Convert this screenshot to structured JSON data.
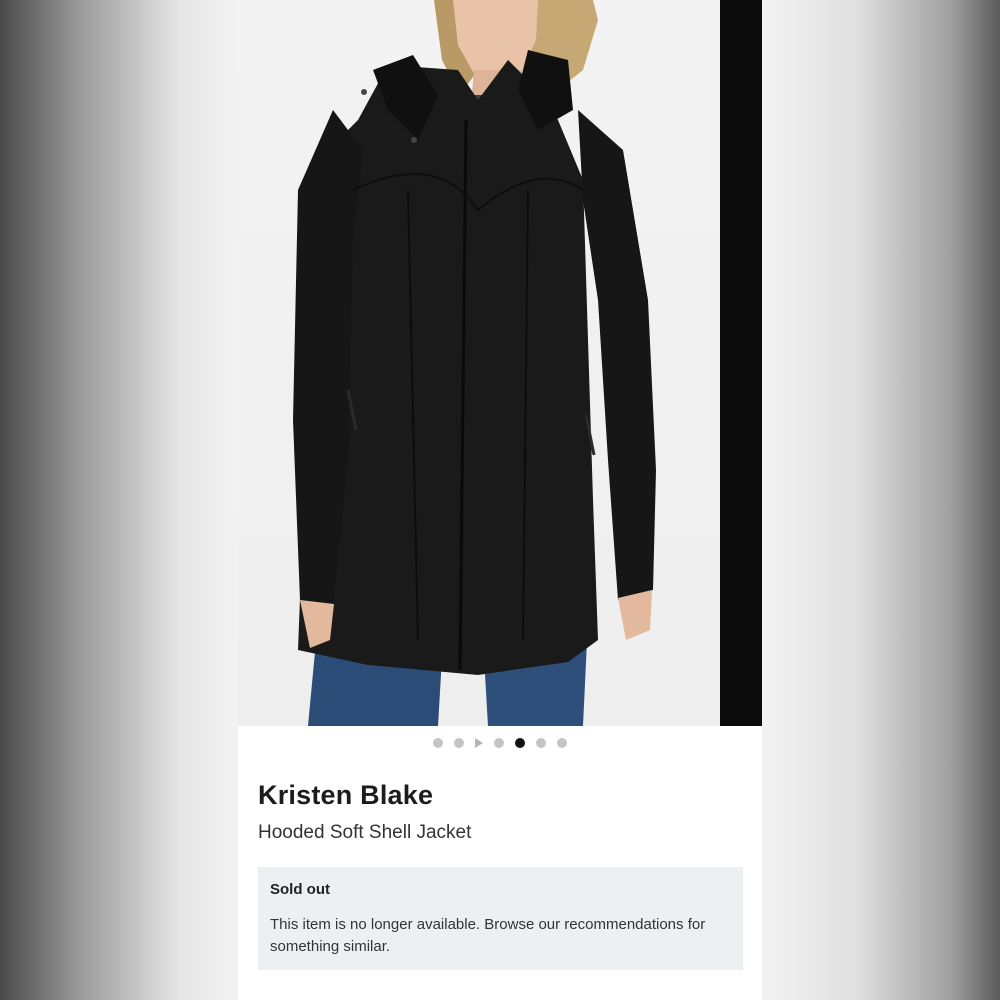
{
  "colors": {
    "page_background": "#f2f2f2",
    "card_background": "#ffffff",
    "notice_background": "#edf0f2",
    "active_dot": "#111111",
    "inactive_dot": "#c4c4c4",
    "jacket": "#1a1a1a",
    "jeans": "#2c4c78"
  },
  "product_image": {
    "description_icon": "photo-model-black-jacket",
    "slides_before_video": 2,
    "has_video_slide": true,
    "slides_after_video": 4,
    "active_slide_index": 4
  },
  "product": {
    "brand": "Kristen Blake",
    "name": "Hooded Soft Shell Jacket"
  },
  "availability": {
    "title": "Sold out",
    "message": "This item is no longer available. Browse our recommendations for something similar."
  }
}
